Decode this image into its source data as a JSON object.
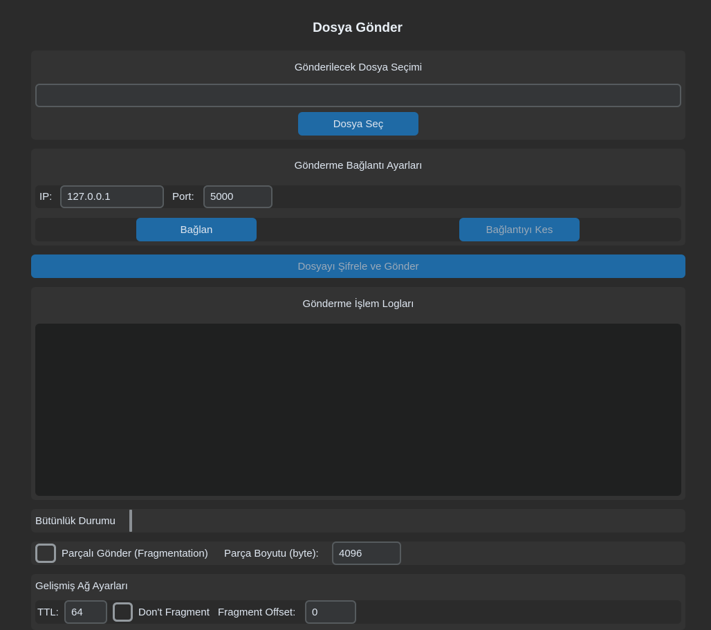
{
  "window": {
    "title": "Dosya Gönder"
  },
  "file_section": {
    "title": "Gönderilecek Dosya Seçimi",
    "path_value": "",
    "select_button": "Dosya Seç"
  },
  "connection_section": {
    "title": "Gönderme Bağlantı Ayarları",
    "ip_label": "IP:",
    "ip_value": "127.0.0.1",
    "port_label": "Port:",
    "port_value": "5000",
    "connect_button": "Bağlan",
    "disconnect_button": "Bağlantıyı Kes"
  },
  "send_button": "Dosyayı Şifrele ve Gönder",
  "log_section": {
    "title": "Gönderme İşlem Logları",
    "content": ""
  },
  "integrity": {
    "label": "Bütünlük Durumu",
    "progress": 0
  },
  "fragmentation": {
    "checkbox_label": "Parçalı Gönder (Fragmentation)",
    "checked": false,
    "size_label": "Parça Boyutu (byte):",
    "size_value": "4096"
  },
  "advanced": {
    "title": "Gelişmiş Ağ Ayarları",
    "ttl_label": "TTL:",
    "ttl_value": "64",
    "dont_fragment_label": "Don't Fragment",
    "dont_fragment_checked": false,
    "offset_label": "Fragment Offset:",
    "offset_value": "0"
  },
  "colors": {
    "background": "#2b2b2b",
    "frame": "#333333",
    "button": "#1f6aa5",
    "entry_border": "#565b5e",
    "log_background": "#1f2020"
  }
}
